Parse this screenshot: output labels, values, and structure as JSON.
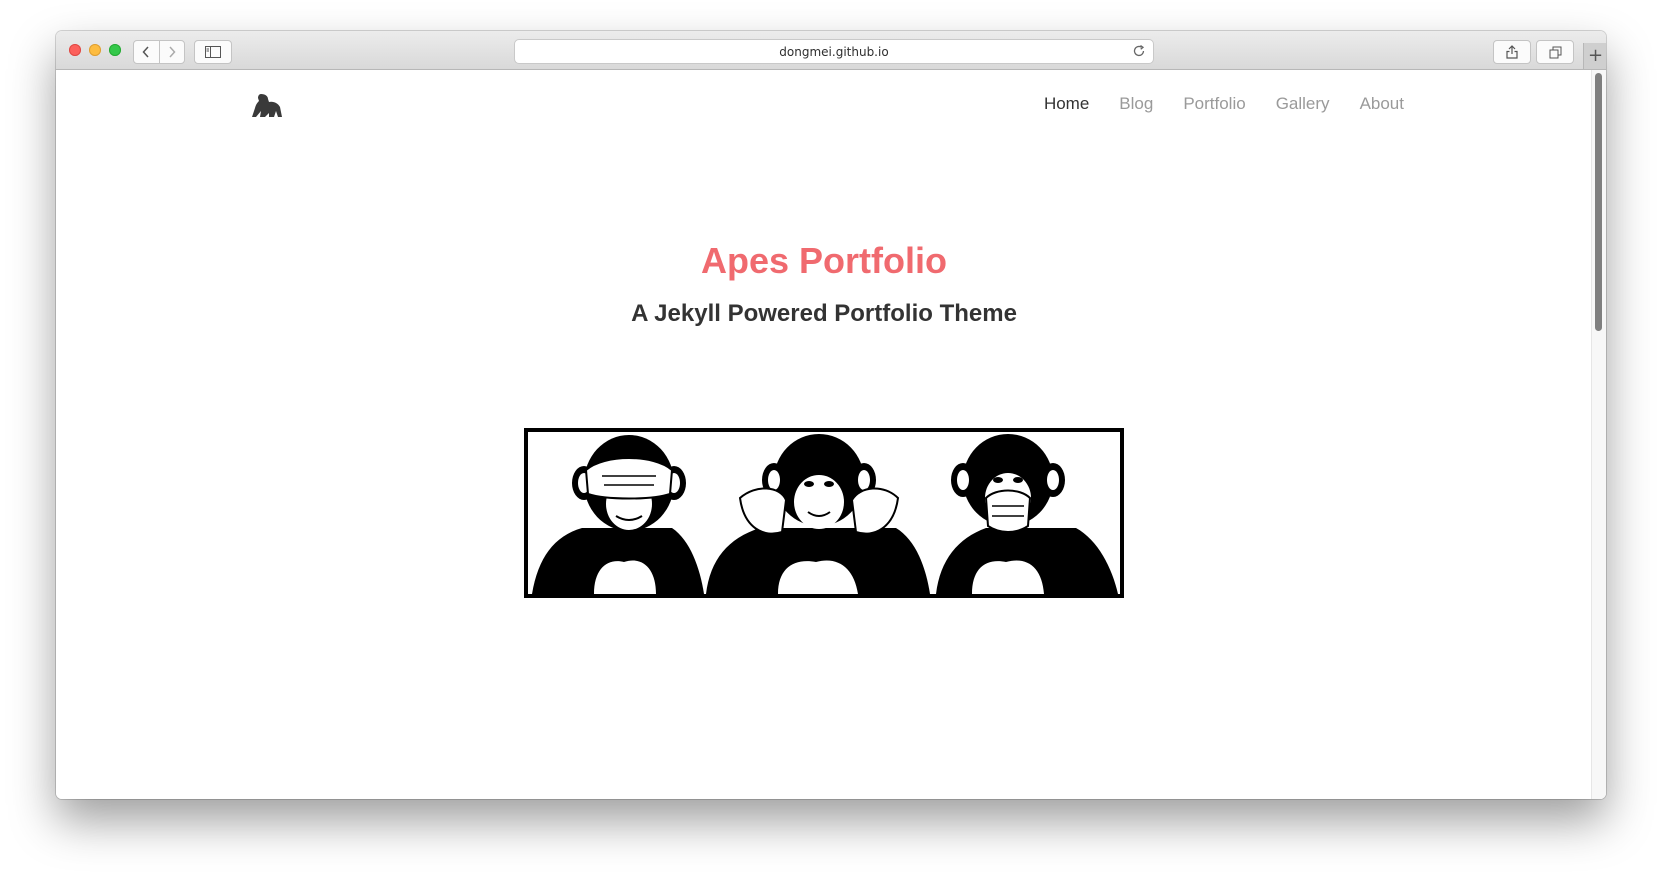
{
  "browser": {
    "url": "dongmei.github.io",
    "newtab_label": "+"
  },
  "site": {
    "logo_icon": "gorilla-icon",
    "nav": [
      {
        "label": "Home",
        "active": true
      },
      {
        "label": "Blog",
        "active": false
      },
      {
        "label": "Portfolio",
        "active": false
      },
      {
        "label": "Gallery",
        "active": false
      },
      {
        "label": "About",
        "active": false
      }
    ]
  },
  "hero": {
    "title": "Apes Portfolio",
    "subtitle": "A Jekyll Powered Portfolio Theme",
    "image_icon": "three-wise-monkeys-icon"
  },
  "colors": {
    "accent": "#f06a6f",
    "nav_active": "#333333",
    "nav_inactive": "#9a9a9a"
  }
}
